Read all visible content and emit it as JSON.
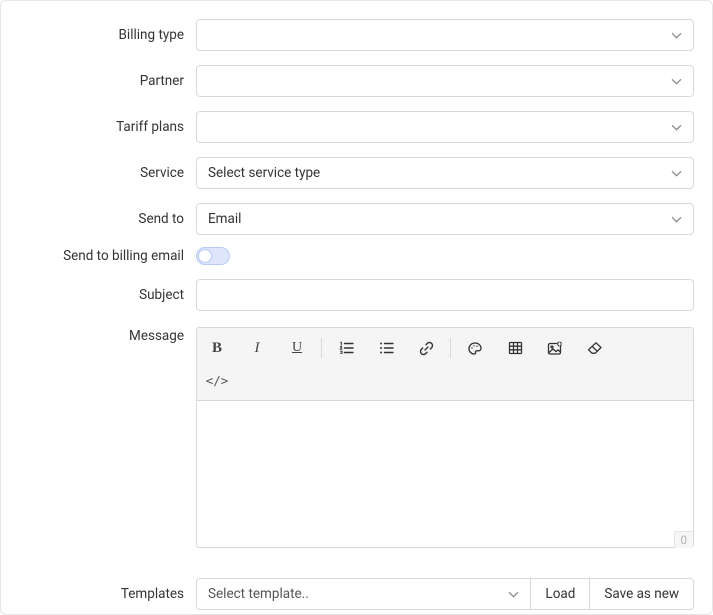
{
  "fields": {
    "billing_type": {
      "label": "Billing type",
      "value": ""
    },
    "partner": {
      "label": "Partner",
      "value": ""
    },
    "tariff_plans": {
      "label": "Tariff plans",
      "value": ""
    },
    "service": {
      "label": "Service",
      "value": "Select service type"
    },
    "send_to": {
      "label": "Send to",
      "value": "Email"
    },
    "send_to_billing_email": {
      "label": "Send to billing email",
      "on": false
    },
    "subject": {
      "label": "Subject",
      "value": ""
    },
    "message": {
      "label": "Message"
    },
    "templates": {
      "label": "Templates",
      "value": "Select template.."
    }
  },
  "editor": {
    "toolbar": {
      "bold": "B",
      "italic": "I",
      "underline": "U",
      "code": "</>"
    },
    "char_count": "0"
  },
  "buttons": {
    "load": "Load",
    "save_as_new": "Save as new"
  }
}
